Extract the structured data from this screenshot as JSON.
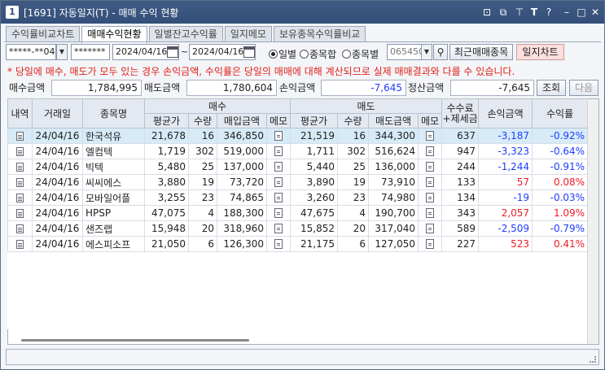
{
  "window": {
    "title": "[1691] 자동일지(T) - 매매 수익 현황",
    "app_icon": "1",
    "buttons": [
      {
        "name": "link-icon",
        "glyph": "⊡"
      },
      {
        "name": "restore-icon",
        "glyph": "⧉"
      },
      {
        "name": "pin-icon",
        "glyph": "⊤"
      },
      {
        "name": "font-size-icon",
        "glyph": "T"
      },
      {
        "name": "help-icon",
        "glyph": "?"
      },
      {
        "name": "minimize-icon",
        "glyph": "–"
      },
      {
        "name": "maximize-icon",
        "glyph": "□"
      },
      {
        "name": "close-icon",
        "glyph": "✕"
      }
    ]
  },
  "tabs": [
    "수익률비교차트",
    "매매수익현황",
    "일별잔고수익률",
    "일지메모",
    "보유종목수익률비교"
  ],
  "active_tab": 1,
  "filters": {
    "account": "*****-**04",
    "password": "*******",
    "date_from": "2024/04/16",
    "tilde": "~",
    "date_to": "2024/04/16",
    "radio_options": [
      "일별",
      "종목합",
      "종목별"
    ],
    "radio_selected": 0,
    "stock_code": "065450",
    "recent_trade_button": "최근매매종목",
    "journal_chart_button": "일지차트"
  },
  "notice": "* 당일에 매수, 매도가 모두 있는 경우 손익금액, 수익률은 당일의 매매에 대해 계산되므로 실제 매매결과와 다를 수 있습니다.",
  "summary": {
    "buy_amount_label": "매수금액",
    "buy_amount": "1,784,995",
    "sell_amount_label": "매도금액",
    "sell_amount": "1,780,604",
    "pnl_label": "손익금액",
    "pnl": "-7,645",
    "settle_label": "정산금액",
    "settle": "-7,645",
    "query_button": "조회",
    "next_button": "다음"
  },
  "grid": {
    "headers_top": {
      "detail": "내역",
      "date": "거래일",
      "stock": "종목명",
      "buy": "매수",
      "sell": "매도",
      "fee_line1": "수수료",
      "fee_line2": "+제세금",
      "pnl": "손익금액",
      "rate": "수익률"
    },
    "headers_sub": {
      "buy_avg": "평균가",
      "buy_qty": "수량",
      "buy_amount": "매입금액",
      "buy_memo": "메모",
      "sell_avg": "평균가",
      "sell_qty": "수량",
      "sell_amount": "매도금액",
      "sell_memo": "메모"
    },
    "rows": [
      {
        "date": "24/04/16",
        "stock": "한국석유",
        "buy_avg": "21,678",
        "buy_qty": "16",
        "buy_amount": "346,850",
        "sell_avg": "21,519",
        "sell_qty": "16",
        "sell_amount": "344,300",
        "fee": "637",
        "pnl": "-3,187",
        "rate": "-0.92%"
      },
      {
        "date": "24/04/16",
        "stock": "엘컴텍",
        "buy_avg": "1,719",
        "buy_qty": "302",
        "buy_amount": "519,000",
        "sell_avg": "1,711",
        "sell_qty": "302",
        "sell_amount": "516,624",
        "fee": "947",
        "pnl": "-3,323",
        "rate": "-0.64%"
      },
      {
        "date": "24/04/16",
        "stock": "빅텍",
        "buy_avg": "5,480",
        "buy_qty": "25",
        "buy_amount": "137,000",
        "sell_avg": "5,440",
        "sell_qty": "25",
        "sell_amount": "136,000",
        "fee": "244",
        "pnl": "-1,244",
        "rate": "-0.91%"
      },
      {
        "date": "24/04/16",
        "stock": "씨씨에스",
        "buy_avg": "3,880",
        "buy_qty": "19",
        "buy_amount": "73,720",
        "sell_avg": "3,890",
        "sell_qty": "19",
        "sell_amount": "73,910",
        "fee": "133",
        "pnl": "57",
        "rate": "0.08%"
      },
      {
        "date": "24/04/16",
        "stock": "모바일어플",
        "buy_avg": "3,255",
        "buy_qty": "23",
        "buy_amount": "74,865",
        "sell_avg": "3,260",
        "sell_qty": "23",
        "sell_amount": "74,980",
        "fee": "134",
        "pnl": "-19",
        "rate": "-0.03%"
      },
      {
        "date": "24/04/16",
        "stock": "HPSP",
        "buy_avg": "47,075",
        "buy_qty": "4",
        "buy_amount": "188,300",
        "sell_avg": "47,675",
        "sell_qty": "4",
        "sell_amount": "190,700",
        "fee": "343",
        "pnl": "2,057",
        "rate": "1.09%"
      },
      {
        "date": "24/04/16",
        "stock": "샌즈랩",
        "buy_avg": "15,948",
        "buy_qty": "20",
        "buy_amount": "318,960",
        "sell_avg": "15,852",
        "sell_qty": "20",
        "sell_amount": "317,040",
        "fee": "589",
        "pnl": "-2,509",
        "rate": "-0.79%"
      },
      {
        "date": "24/04/16",
        "stock": "에스피소프",
        "buy_avg": "21,050",
        "buy_qty": "6",
        "buy_amount": "126,300",
        "sell_avg": "21,175",
        "sell_qty": "6",
        "sell_amount": "127,050",
        "fee": "227",
        "pnl": "523",
        "rate": "0.41%"
      }
    ],
    "selected_row": 0
  },
  "colors": {
    "title_bar": "#34507a",
    "notice": "#e0201a",
    "negative": "#1e3cff",
    "positive": "#ee1c25",
    "selected_row": "#d6ebf7",
    "header_bg": "#e4e9f1"
  }
}
